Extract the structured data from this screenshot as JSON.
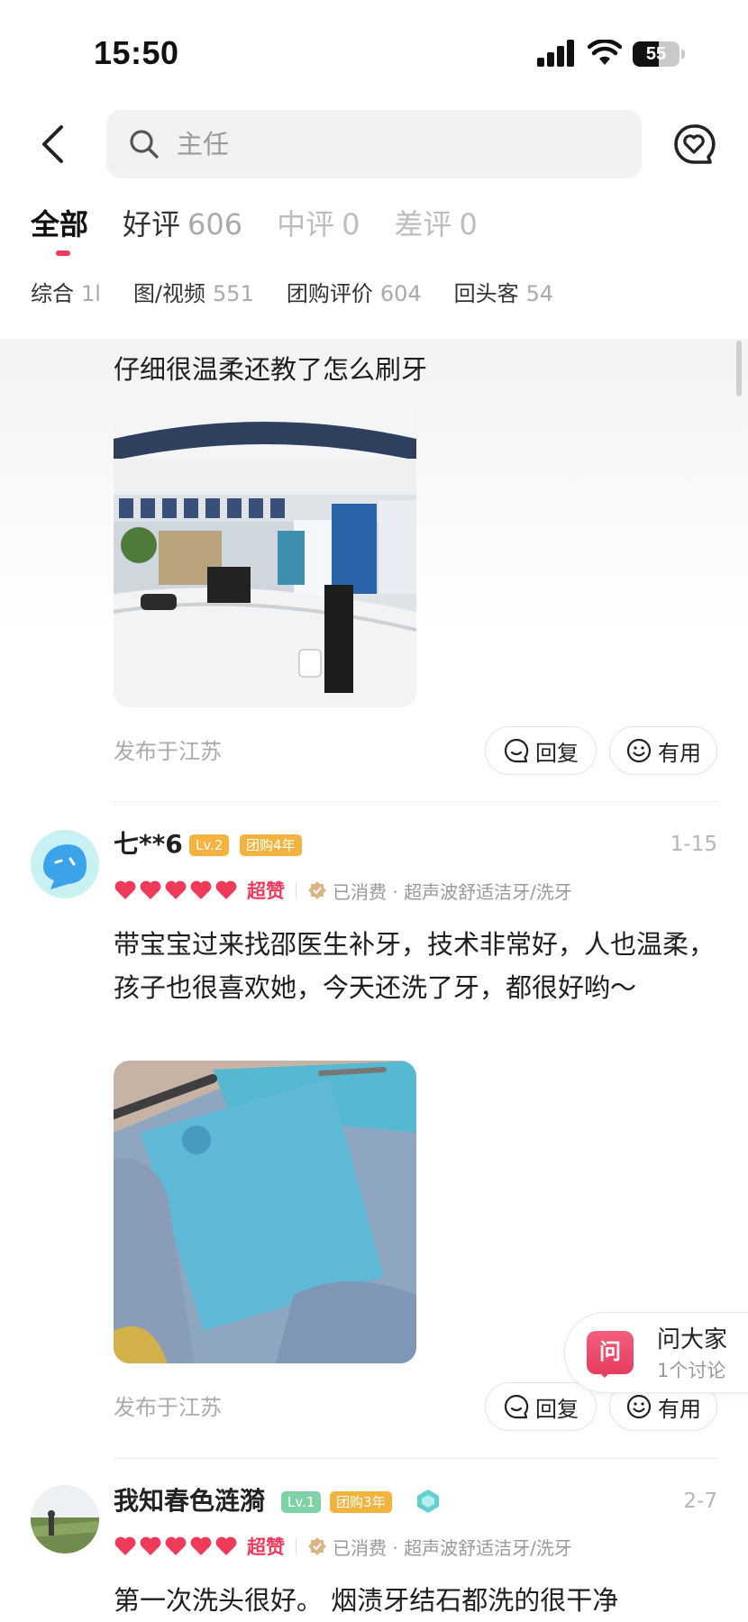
{
  "status_bar": {
    "time": "15:50",
    "battery": "55",
    "battery_level": 0.55
  },
  "search": {
    "placeholder": "主任"
  },
  "tabs": [
    {
      "label": "全部",
      "count": ""
    },
    {
      "label": "好评",
      "count": "606"
    },
    {
      "label": "中评",
      "count": "0"
    },
    {
      "label": "差评",
      "count": "0"
    }
  ],
  "filters": [
    {
      "label": "综合",
      "count": "1l"
    },
    {
      "label": "图/视频",
      "count": "551"
    },
    {
      "label": "团购评价",
      "count": "604"
    },
    {
      "label": "回头客",
      "count": "54"
    }
  ],
  "reviews": [
    {
      "text": "仔细很温柔还教了怎么刷牙",
      "location": "发布于江苏",
      "reply_label": "回复",
      "useful_label": "有用"
    },
    {
      "username": "七**6",
      "level": "Lv.2",
      "group_years": "团购4年",
      "date": "1-15",
      "rating_word": "超赞",
      "consumed": "已消费 · 超声波舒适洁牙/洗牙",
      "text": "带宝宝过来找邵医生补牙，技术非常好，人也温柔，孩子也很喜欢她，今天还洗了牙，都很好哟～",
      "location": "发布于江苏",
      "reply_label": "回复",
      "useful_label": "有用"
    },
    {
      "username": "我知春色涟漪",
      "level": "Lv.1",
      "group_years": "团购3年",
      "date": "2-7",
      "rating_word": "超赞",
      "consumed": "已消费 · 超声波舒适洁牙/洗牙",
      "text": "第一次洗头很好。 烟渍牙结石都洗的很干净"
    }
  ],
  "ask": {
    "icon_text": "问",
    "title": "问大家",
    "subtitle": "1个讨论"
  },
  "colors": {
    "accent": "#ef3a5b",
    "level2": "#f5b23c",
    "level1": "#7fd1a6",
    "group": "#f2b43f"
  },
  "icons": [
    "back-icon",
    "search-icon",
    "heart-chat-icon",
    "comment-icon",
    "smile-icon",
    "heart-icon",
    "verified-icon",
    "diamond-icon"
  ]
}
